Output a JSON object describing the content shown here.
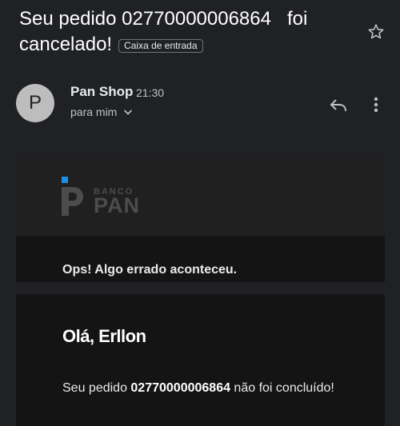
{
  "subject": {
    "line1": "Seu pedido 02770000006864   foi",
    "line2": "cancelado!",
    "label": "Caixa de entrada"
  },
  "sender": {
    "initial": "P",
    "name": "Pan Shop",
    "time": "21:30",
    "recipient": "para mim"
  },
  "icons": {
    "star": "star-icon",
    "reply": "reply-icon",
    "more": "more-vert-icon",
    "chevron": "chevron-down-icon"
  },
  "brand": {
    "banco": "BANCO",
    "pan": "PAN",
    "accent_color": "#1a8fe3"
  },
  "body": {
    "error_message": "Ops! Algo errado aconteceu.",
    "greeting": "Olá, Erllon",
    "order_prefix": "Seu pedido ",
    "order_number": "02770000006864",
    "order_suffix": " não foi concluído!"
  }
}
